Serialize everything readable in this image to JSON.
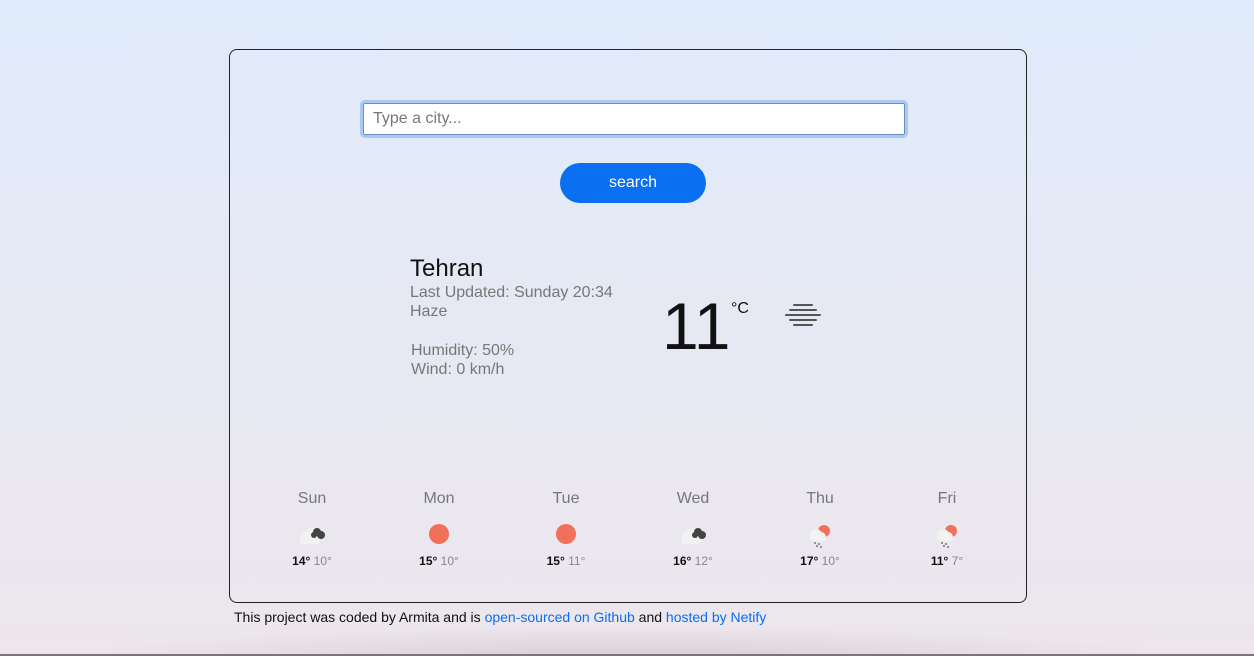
{
  "search": {
    "placeholder": "Type a city...",
    "value": "",
    "button_label": "search"
  },
  "current": {
    "city": "Tehran",
    "last_updated": "Last Updated: Sunday 20:34",
    "condition": "Haze",
    "humidity": "Humidity: 50%",
    "wind": "Wind: 0 km/h",
    "temperature": "11",
    "unit": "°C",
    "icon": "haze-icon"
  },
  "forecast": [
    {
      "day": "Sun",
      "max": "14°",
      "min": "10°",
      "icon": "cloudy-icon"
    },
    {
      "day": "Mon",
      "max": "15°",
      "min": "10°",
      "icon": "sun-icon"
    },
    {
      "day": "Tue",
      "max": "15°",
      "min": "11°",
      "icon": "sun-icon"
    },
    {
      "day": "Wed",
      "max": "16°",
      "min": "12°",
      "icon": "cloudy-icon"
    },
    {
      "day": "Thu",
      "max": "17°",
      "min": "10°",
      "icon": "rain-sun-icon"
    },
    {
      "day": "Fri",
      "max": "11°",
      "min": "7°",
      "icon": "rain-sun-icon"
    }
  ],
  "footer": {
    "text1": "This project was coded by Armita and is",
    "link1": "open-sourced on Github",
    "text2": "and",
    "link2": "hosted by Netify"
  },
  "colors": {
    "accent": "#0a6ff0",
    "sun": "#f0705a"
  }
}
